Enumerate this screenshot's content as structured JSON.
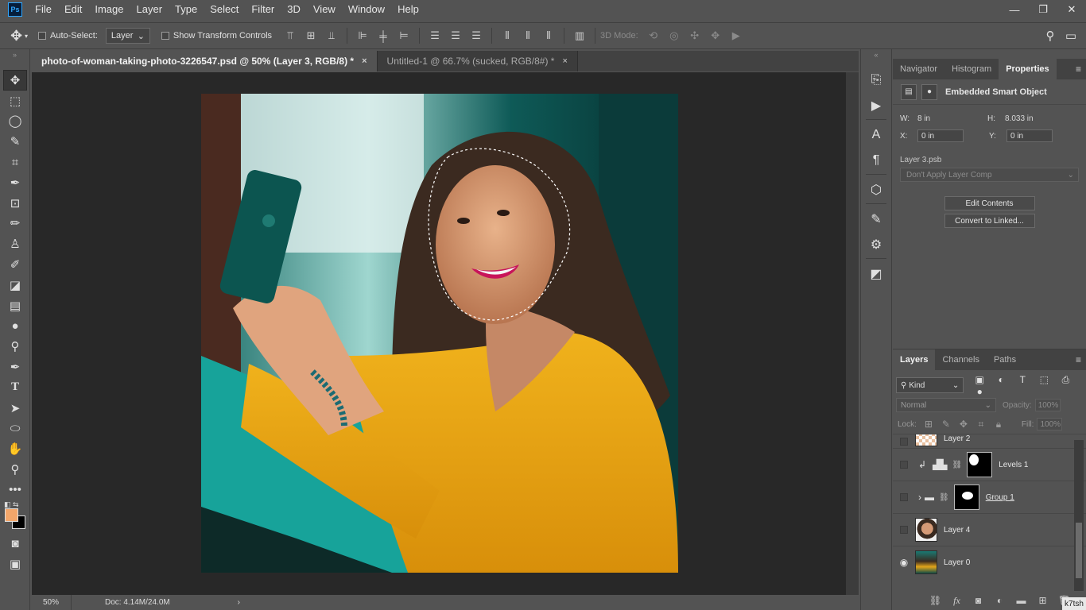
{
  "app": {
    "logo": "Ps"
  },
  "menu": [
    "File",
    "Edit",
    "Image",
    "Layer",
    "Type",
    "Select",
    "Filter",
    "3D",
    "View",
    "Window",
    "Help"
  ],
  "window_controls": {
    "minimize": "—",
    "restore": "❐",
    "close": "✕"
  },
  "options": {
    "auto_select_label": "Auto-Select:",
    "auto_select_value": "Layer",
    "show_transform_label": "Show Transform Controls",
    "mode_3d_label": "3D Mode:"
  },
  "tabs": [
    {
      "label": "photo-of-woman-taking-photo-3226547.psd @ 50% (Layer 3, RGB/8) *",
      "close": "×"
    },
    {
      "label": "Untitled-1 @ 66.7% (sucked, RGB/8#) *",
      "close": "×"
    }
  ],
  "status": {
    "zoom": "50%",
    "doc": "Doc: 4.14M/24.0M",
    "arrow": "›"
  },
  "properties_panel": {
    "tabs": [
      "Navigator",
      "Histogram",
      "Properties"
    ],
    "title": "Embedded Smart Object",
    "w_label": "W:",
    "w_value": "8 in",
    "h_label": "H:",
    "h_value": "8.033 in",
    "x_label": "X:",
    "x_value": "0 in",
    "y_label": "Y:",
    "y_value": "0 in",
    "layer_name": "Layer 3.psb",
    "layer_comp": "Don't Apply Layer Comp",
    "edit_contents": "Edit Contents",
    "convert_linked": "Convert to Linked..."
  },
  "layers_panel": {
    "tabs": [
      "Layers",
      "Channels",
      "Paths"
    ],
    "kind_label": "Kind",
    "blend_mode": "Normal",
    "opacity_label": "Opacity:",
    "opacity_value": "100%",
    "lock_label": "Lock:",
    "fill_label": "Fill:",
    "fill_value": "100%",
    "layers": [
      {
        "name": "Layer 2",
        "visible": false
      },
      {
        "name": "Levels 1",
        "visible": false
      },
      {
        "name": "Group 1",
        "visible": false
      },
      {
        "name": "Layer 4",
        "visible": false
      },
      {
        "name": "Layer 0",
        "visible": true
      }
    ]
  },
  "watermark": "k7tsh",
  "colors": {
    "foreground": "#f3a66a",
    "background": "#000000",
    "panel": "#535353",
    "canvas": "#282828"
  }
}
